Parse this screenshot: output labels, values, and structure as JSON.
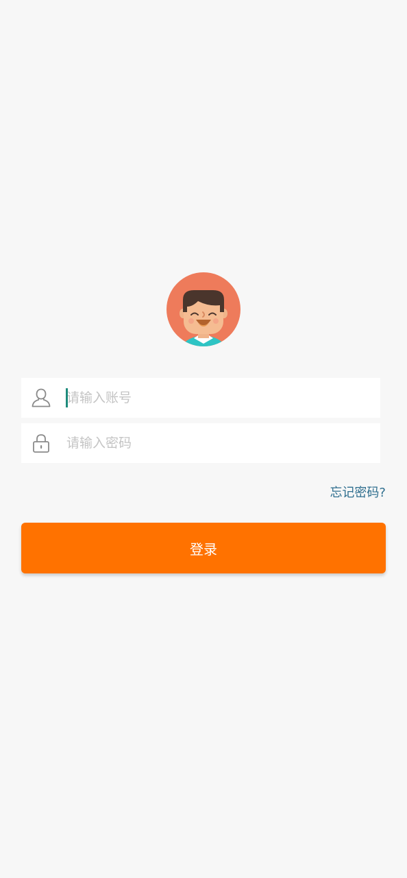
{
  "avatar": {
    "icon": "boy-avatar-icon",
    "background_color": "#ee7b5b"
  },
  "account_field": {
    "icon": "user-icon",
    "placeholder": "请输入账号",
    "value": ""
  },
  "password_field": {
    "icon": "lock-icon",
    "placeholder": "请输入密码",
    "value": ""
  },
  "forgot_password": {
    "label": "忘记密码?"
  },
  "login_button": {
    "label": "登录",
    "color": "#ff7200"
  }
}
